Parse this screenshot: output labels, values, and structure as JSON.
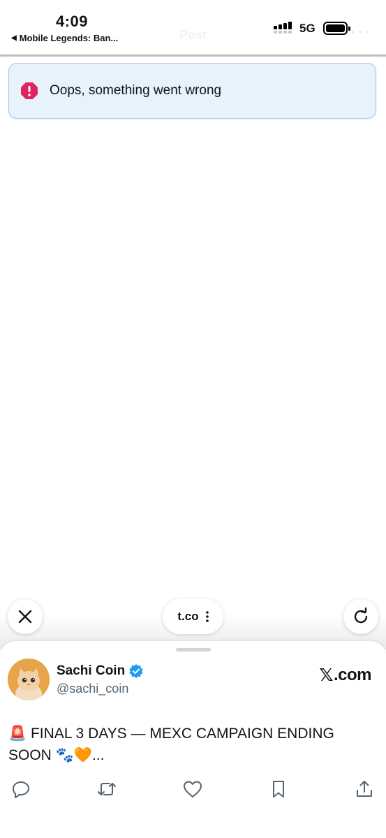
{
  "status_bar": {
    "time": "4:09",
    "back_app": "Mobile Legends: Ban...",
    "network": "5G",
    "ghost_title": "Post"
  },
  "toast": {
    "message": "Oops, something went wrong",
    "icon": "error-octagon-icon",
    "accent": "#e0245e"
  },
  "browser": {
    "url": "t.co"
  },
  "preview": {
    "display_name": "Sachi Coin",
    "handle": "@sachi_coin",
    "brand": ".com",
    "verified_color": "#1d9bf0",
    "post_text": "🚨 FINAL 3 DAYS — MEXC CAMPAIGN ENDING SOON 🐾🧡...",
    "actions": [
      "reply-icon",
      "repost-icon",
      "like-icon",
      "bookmark-icon",
      "share-icon"
    ]
  }
}
